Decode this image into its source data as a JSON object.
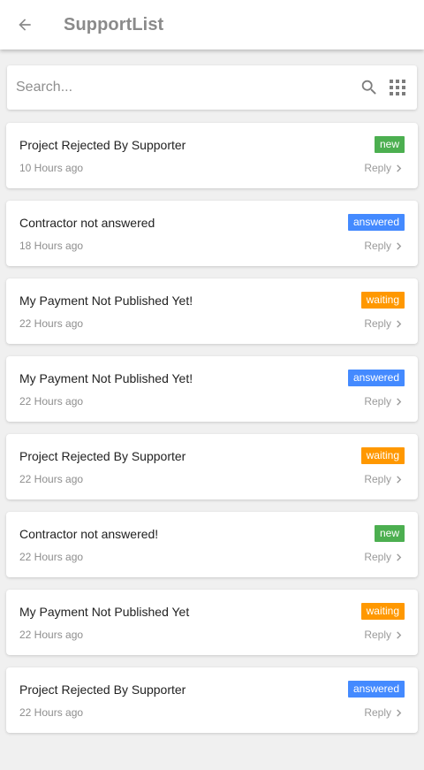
{
  "header": {
    "title": "SupportList",
    "back_icon": "arrow-left-icon"
  },
  "search": {
    "placeholder": "Search...",
    "value": "",
    "search_icon": "search-icon",
    "grid_icon": "apps-grid-icon"
  },
  "colors": {
    "new": "#4caf50",
    "answered": "#448aff",
    "waiting": "#ff9800"
  },
  "tickets": [
    {
      "title": "Project Rejected By Supporter",
      "time": "10 Hours ago",
      "status": "new",
      "reply": "Reply"
    },
    {
      "title": "Contractor not answered",
      "time": "18 Hours ago",
      "status": "answered",
      "reply": "Reply"
    },
    {
      "title": "My Payment Not Published Yet!",
      "time": "22 Hours ago",
      "status": "waiting",
      "reply": "Reply"
    },
    {
      "title": "My Payment Not Published Yet!",
      "time": "22 Hours ago",
      "status": "answered",
      "reply": "Reply"
    },
    {
      "title": "Project Rejected By Supporter",
      "time": "22 Hours ago",
      "status": "waiting",
      "reply": "Reply"
    },
    {
      "title": "Contractor not answered!",
      "time": "22 Hours ago",
      "status": "new",
      "reply": "Reply"
    },
    {
      "title": "My Payment Not Published Yet",
      "time": "22 Hours ago",
      "status": "waiting",
      "reply": "Reply"
    },
    {
      "title": "Project Rejected By Supporter",
      "time": "22 Hours ago",
      "status": "answered",
      "reply": "Reply"
    }
  ]
}
